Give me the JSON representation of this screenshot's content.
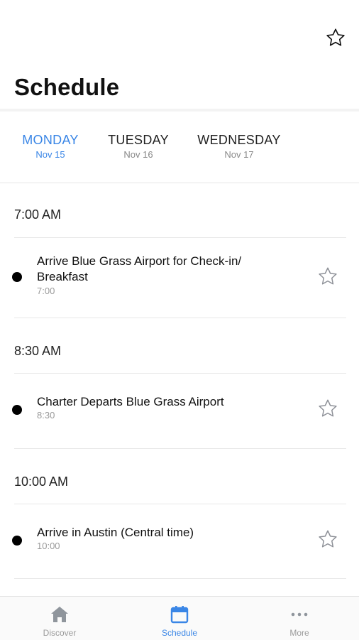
{
  "header": {
    "title": "Schedule",
    "favorite_icon": "star-outline-icon"
  },
  "days": [
    {
      "name": "MONDAY",
      "date": "Nov 15",
      "active": true
    },
    {
      "name": "TUESDAY",
      "date": "Nov 16",
      "active": false
    },
    {
      "name": "WEDNESDAY",
      "date": "Nov 17",
      "active": false
    }
  ],
  "schedule": [
    {
      "time": "7:00 AM",
      "event": {
        "title": "Arrive Blue Grass Airport for Check-in/ Breakfast",
        "time": "7:00",
        "icon": "star-outline-icon"
      }
    },
    {
      "time": "8:30 AM",
      "event": {
        "title": "Charter Departs Blue Grass Airport",
        "time": "8:30",
        "icon": "star-outline-icon"
      }
    },
    {
      "time": "10:00 AM",
      "event": {
        "title": "Arrive in Austin (Central time)",
        "time": "10:00",
        "icon": "star-outline-icon"
      }
    }
  ],
  "tab_bar": {
    "items": [
      {
        "label": "Discover",
        "icon": "home-icon",
        "active": false
      },
      {
        "label": "Schedule",
        "icon": "calendar-icon",
        "active": true
      },
      {
        "label": "More",
        "icon": "more-dots-icon",
        "active": false
      }
    ]
  },
  "colors": {
    "accent": "#3a86e6",
    "inactive": "#9a9a9a",
    "text": "#111111"
  }
}
